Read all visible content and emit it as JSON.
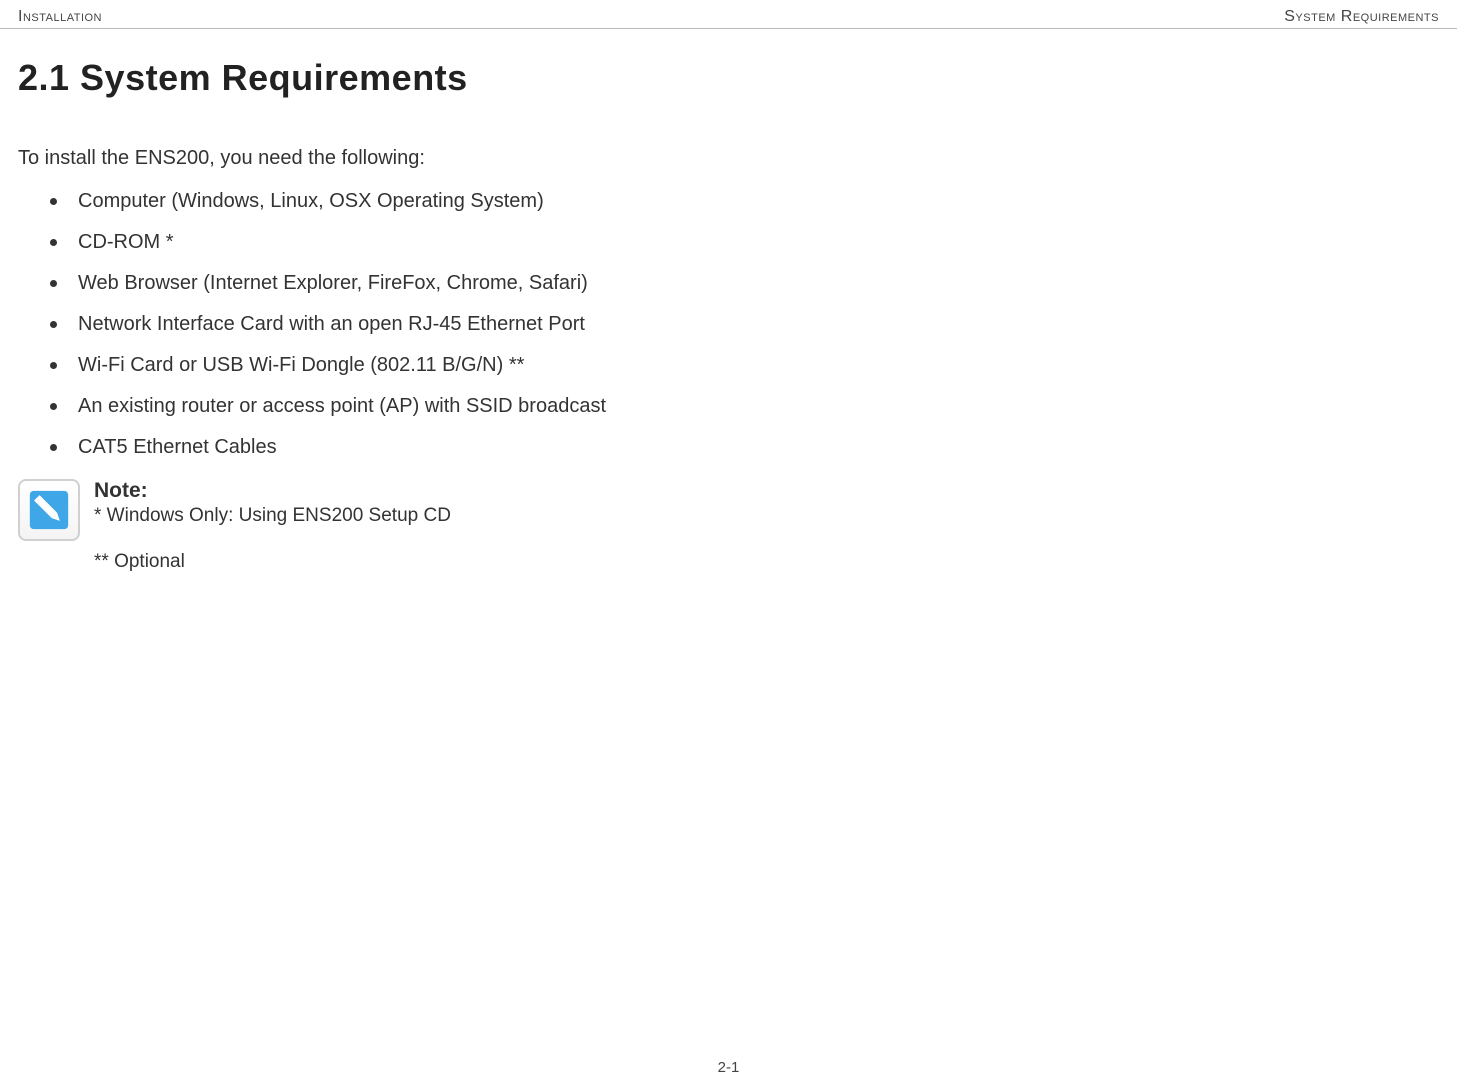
{
  "header": {
    "left": "Installation",
    "right": "System Requirements"
  },
  "section": {
    "number_title": "2.1 System Requirements",
    "intro": "To install the ENS200, you need the following:",
    "items": [
      "Computer (Windows, Linux, OSX Operating System)",
      "CD-ROM *",
      "Web Browser (Internet Explorer, FireFox, Chrome, Safari)",
      "Network Interface Card with an open RJ-45 Ethernet Port",
      "Wi-Fi Card or USB Wi-Fi Dongle (802.11 B/G/N) **",
      "An existing router or access point (AP) with SSID broadcast",
      "CAT5 Ethernet Cables"
    ]
  },
  "note": {
    "label": "Note:",
    "line1": "* Windows Only: Using ENS200 Setup CD",
    "line2": "** Optional"
  },
  "footer": {
    "page": "2-1"
  }
}
